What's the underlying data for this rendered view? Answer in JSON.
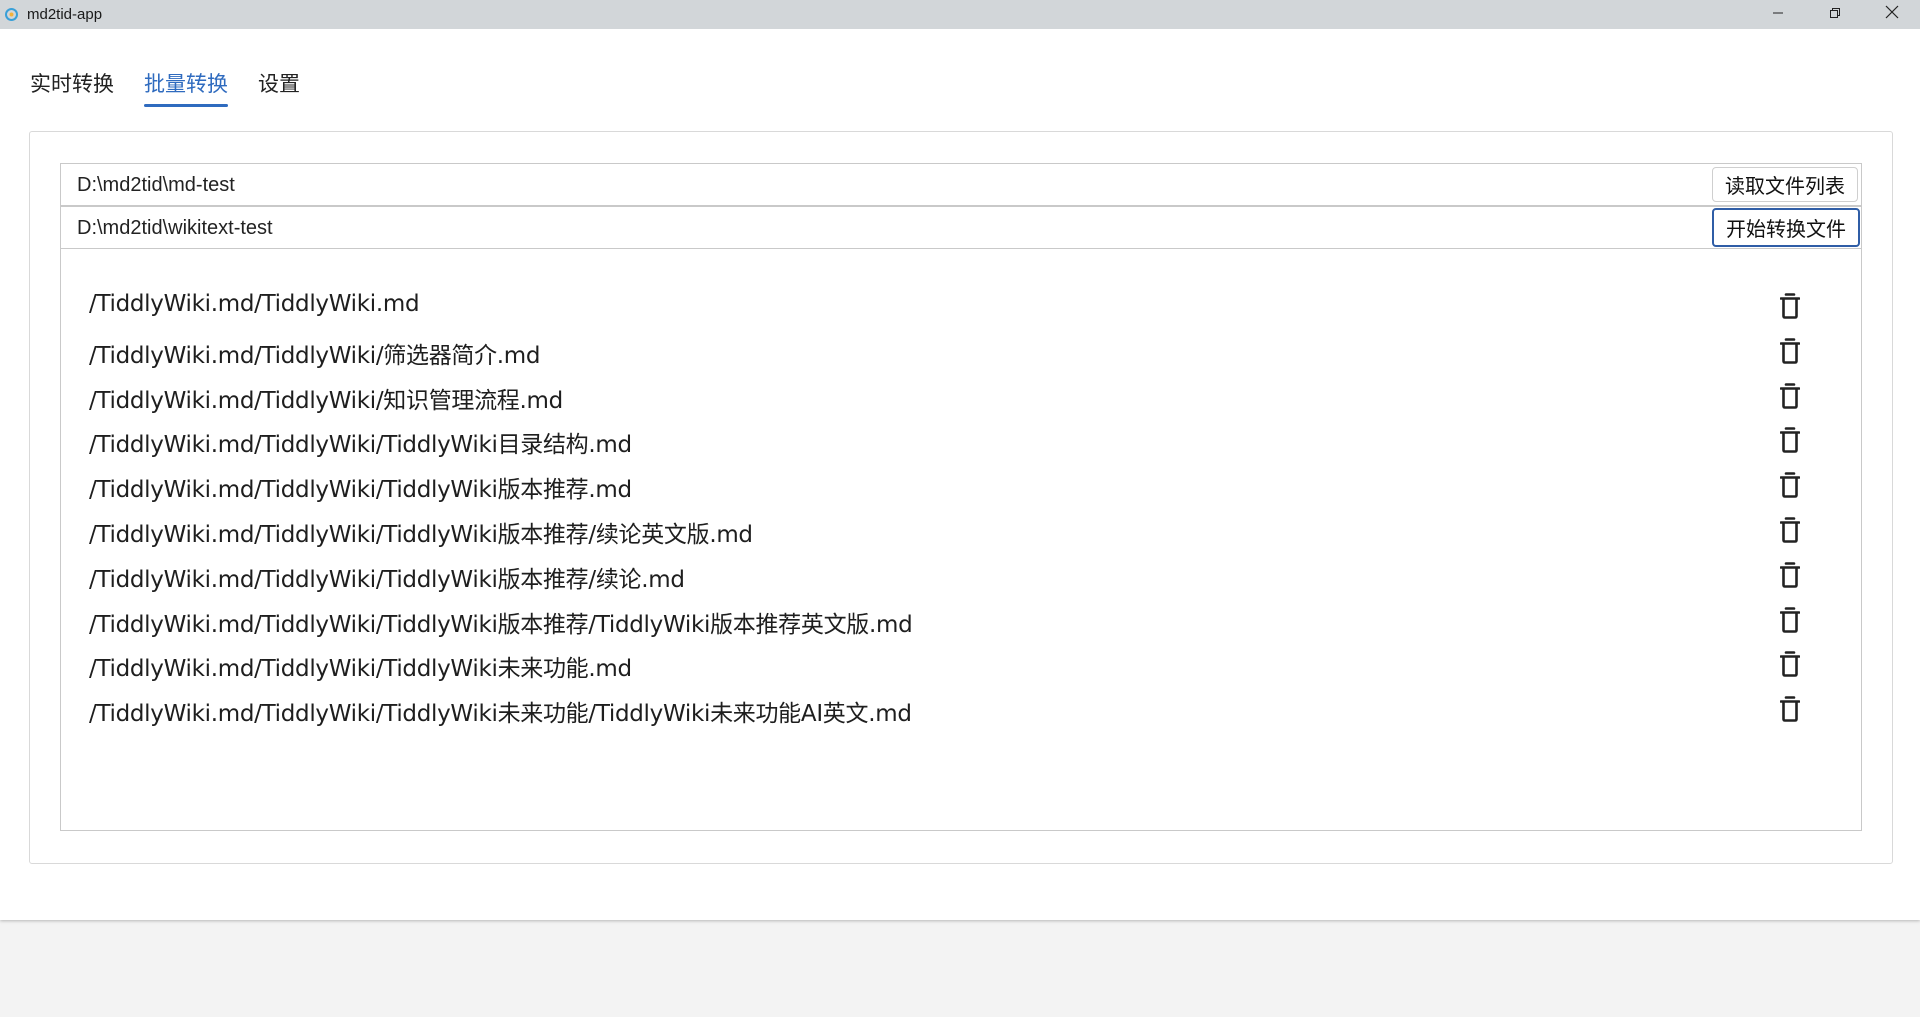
{
  "window": {
    "title": "md2tid-app",
    "controls": [
      "minimize-icon",
      "restore-icon",
      "close-icon"
    ]
  },
  "tabs": [
    {
      "label": "实时转换",
      "active": false
    },
    {
      "label": "批量转换",
      "active": true
    },
    {
      "label": "设置",
      "active": false
    }
  ],
  "batch": {
    "source_path": "D:\\md2tid\\md-test",
    "target_path": "D:\\md2tid\\wikitext-test",
    "read_button_label": "读取文件列表",
    "convert_button_label": "开始转换文件"
  },
  "files": [
    "/TiddlyWiki.md/TiddlyWiki.md",
    "/TiddlyWiki.md/TiddlyWiki/筛选器简介.md",
    "/TiddlyWiki.md/TiddlyWiki/知识管理流程.md",
    "/TiddlyWiki.md/TiddlyWiki/TiddlyWiki目录结构.md",
    "/TiddlyWiki.md/TiddlyWiki/TiddlyWiki版本推荐.md",
    "/TiddlyWiki.md/TiddlyWiki/TiddlyWiki版本推荐/续论英文版.md",
    "/TiddlyWiki.md/TiddlyWiki/TiddlyWiki版本推荐/续论.md",
    "/TiddlyWiki.md/TiddlyWiki/TiddlyWiki版本推荐/TiddlyWiki版本推荐英文版.md",
    "/TiddlyWiki.md/TiddlyWiki/TiddlyWiki未来功能.md",
    "/TiddlyWiki.md/TiddlyWiki/TiddlyWiki未来功能/TiddlyWiki未来功能AI英文.md"
  ],
  "icons": {
    "delete": "trash-icon"
  },
  "colors": {
    "accent": "#2f6bbf",
    "titlebar": "#d2d6d9"
  }
}
